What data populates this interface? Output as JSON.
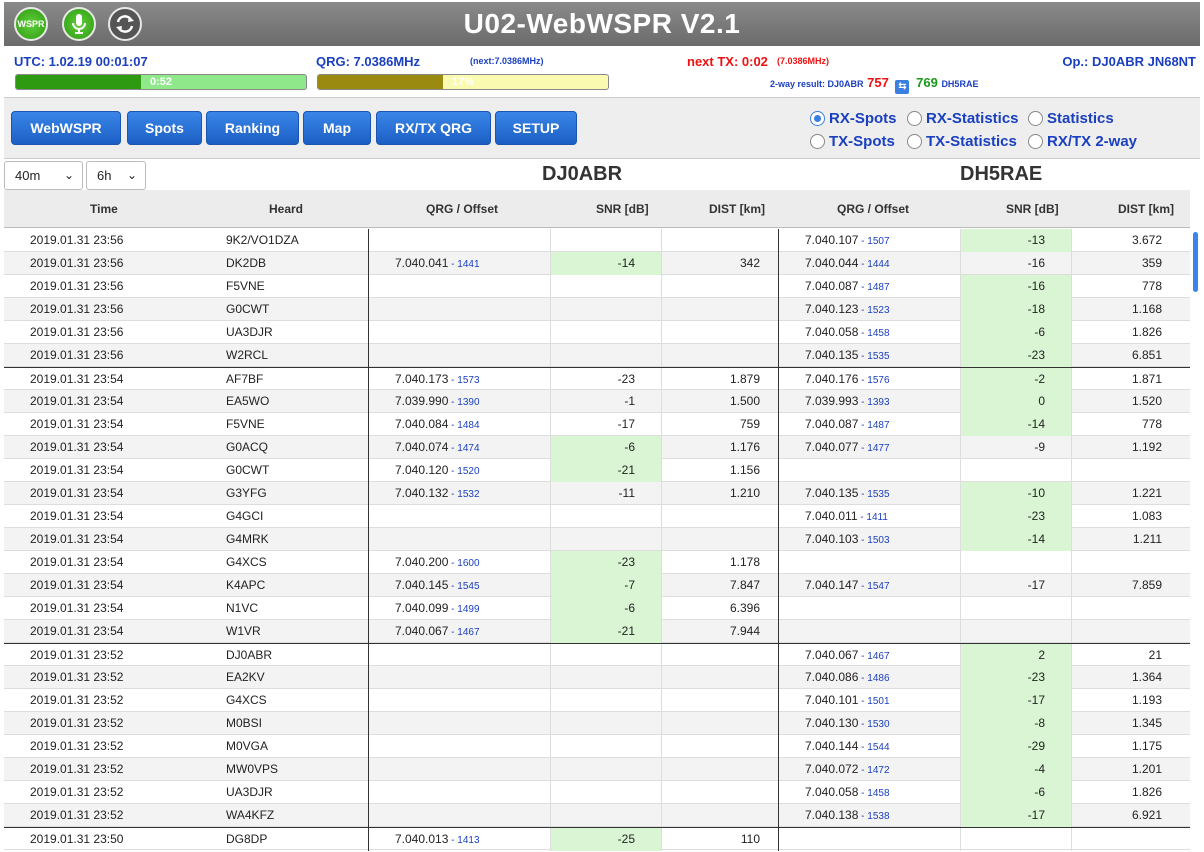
{
  "title": "U02-WebWSPR V2.1",
  "toolbar_icons": [
    "wspr-icon",
    "microphone-icon",
    "refresh-icon"
  ],
  "wspr_icon_label": "WSPR",
  "status": {
    "utc": "UTC: 1.02.19 00:01:07",
    "qrg": "QRG: 7.0386MHz",
    "next_qrg": "(next:7.0386MHz)",
    "next_tx": "next TX: 0:02",
    "next_tx_qrg": "(7.0386MHz)",
    "op": "Op.: DJ0ABR JN68NT",
    "timer_text": "0:52",
    "timer_fraction": 0.43,
    "progress_text": "17%",
    "progress_fraction": 0.43,
    "twoway_label": "2-way result: DJ0ABR",
    "twoway_a": "757",
    "twoway_b": "769",
    "twoway_b_call": "DH5RAE"
  },
  "nav": [
    "WebWSPR",
    "Spots",
    "Ranking",
    "Map",
    "RX/TX QRG",
    "SETUP"
  ],
  "views": [
    {
      "label": "RX-Spots",
      "selected": true
    },
    {
      "label": "RX-Statistics",
      "selected": false
    },
    {
      "label": "Statistics",
      "selected": false
    },
    {
      "label": "TX-Spots",
      "selected": false
    },
    {
      "label": "TX-Statistics",
      "selected": false
    },
    {
      "label": "RX/TX 2-way",
      "selected": false
    }
  ],
  "filters": {
    "band": "40m",
    "period": "6h"
  },
  "stations": {
    "a": "DJ0ABR",
    "b": "DH5RAE"
  },
  "columns": {
    "time": "Time",
    "heard": "Heard",
    "qrg1": "QRG / Offset",
    "snr1": "SNR [dB]",
    "dist1": "DIST [km]",
    "qrg2": "QRG / Offset",
    "snr2": "SNR [dB]",
    "dist2": "DIST [km]"
  },
  "rows": [
    {
      "t": "2019.01.31 23:56",
      "h": "9K2/VO1DZA",
      "q1": "",
      "o1": "",
      "s1": "",
      "d1": "",
      "q2": "7.040.107",
      "o2": "1507",
      "s2": "-13",
      "d2": "3.672",
      "g": false,
      "hl1": false,
      "hl2": true
    },
    {
      "t": "2019.01.31 23:56",
      "h": "DK2DB",
      "q1": "7.040.041",
      "o1": "1441",
      "s1": "-14",
      "d1": "342",
      "q2": "7.040.044",
      "o2": "1444",
      "s2": "-16",
      "d2": "359",
      "g": false,
      "hl1": true,
      "hl2": false
    },
    {
      "t": "2019.01.31 23:56",
      "h": "F5VNE",
      "q1": "",
      "o1": "",
      "s1": "",
      "d1": "",
      "q2": "7.040.087",
      "o2": "1487",
      "s2": "-16",
      "d2": "778",
      "g": false,
      "hl1": false,
      "hl2": true
    },
    {
      "t": "2019.01.31 23:56",
      "h": "G0CWT",
      "q1": "",
      "o1": "",
      "s1": "",
      "d1": "",
      "q2": "7.040.123",
      "o2": "1523",
      "s2": "-18",
      "d2": "1.168",
      "g": false,
      "hl1": false,
      "hl2": true
    },
    {
      "t": "2019.01.31 23:56",
      "h": "UA3DJR",
      "q1": "",
      "o1": "",
      "s1": "",
      "d1": "",
      "q2": "7.040.058",
      "o2": "1458",
      "s2": "-6",
      "d2": "1.826",
      "g": false,
      "hl1": false,
      "hl2": true
    },
    {
      "t": "2019.01.31 23:56",
      "h": "W2RCL",
      "q1": "",
      "o1": "",
      "s1": "",
      "d1": "",
      "q2": "7.040.135",
      "o2": "1535",
      "s2": "-23",
      "d2": "6.851",
      "g": false,
      "hl1": false,
      "hl2": true
    },
    {
      "t": "2019.01.31 23:54",
      "h": "AF7BF",
      "q1": "7.040.173",
      "o1": "1573",
      "s1": "-23",
      "d1": "1.879",
      "q2": "7.040.176",
      "o2": "1576",
      "s2": "-2",
      "d2": "1.871",
      "g": true,
      "hl1": false,
      "hl2": true
    },
    {
      "t": "2019.01.31 23:54",
      "h": "EA5WO",
      "q1": "7.039.990",
      "o1": "1390",
      "s1": "-1",
      "d1": "1.500",
      "q2": "7.039.993",
      "o2": "1393",
      "s2": "0",
      "d2": "1.520",
      "g": false,
      "hl1": false,
      "hl2": true
    },
    {
      "t": "2019.01.31 23:54",
      "h": "F5VNE",
      "q1": "7.040.084",
      "o1": "1484",
      "s1": "-17",
      "d1": "759",
      "q2": "7.040.087",
      "o2": "1487",
      "s2": "-14",
      "d2": "778",
      "g": false,
      "hl1": false,
      "hl2": true
    },
    {
      "t": "2019.01.31 23:54",
      "h": "G0ACQ",
      "q1": "7.040.074",
      "o1": "1474",
      "s1": "-6",
      "d1": "1.176",
      "q2": "7.040.077",
      "o2": "1477",
      "s2": "-9",
      "d2": "1.192",
      "g": false,
      "hl1": true,
      "hl2": false
    },
    {
      "t": "2019.01.31 23:54",
      "h": "G0CWT",
      "q1": "7.040.120",
      "o1": "1520",
      "s1": "-21",
      "d1": "1.156",
      "q2": "",
      "o2": "",
      "s2": "",
      "d2": "",
      "g": false,
      "hl1": true,
      "hl2": false
    },
    {
      "t": "2019.01.31 23:54",
      "h": "G3YFG",
      "q1": "7.040.132",
      "o1": "1532",
      "s1": "-11",
      "d1": "1.210",
      "q2": "7.040.135",
      "o2": "1535",
      "s2": "-10",
      "d2": "1.221",
      "g": false,
      "hl1": false,
      "hl2": true
    },
    {
      "t": "2019.01.31 23:54",
      "h": "G4GCI",
      "q1": "",
      "o1": "",
      "s1": "",
      "d1": "",
      "q2": "7.040.011",
      "o2": "1411",
      "s2": "-23",
      "d2": "1.083",
      "g": false,
      "hl1": false,
      "hl2": true
    },
    {
      "t": "2019.01.31 23:54",
      "h": "G4MRK",
      "q1": "",
      "o1": "",
      "s1": "",
      "d1": "",
      "q2": "7.040.103",
      "o2": "1503",
      "s2": "-14",
      "d2": "1.211",
      "g": false,
      "hl1": false,
      "hl2": true
    },
    {
      "t": "2019.01.31 23:54",
      "h": "G4XCS",
      "q1": "7.040.200",
      "o1": "1600",
      "s1": "-23",
      "d1": "1.178",
      "q2": "",
      "o2": "",
      "s2": "",
      "d2": "",
      "g": false,
      "hl1": true,
      "hl2": false
    },
    {
      "t": "2019.01.31 23:54",
      "h": "K4APC",
      "q1": "7.040.145",
      "o1": "1545",
      "s1": "-7",
      "d1": "7.847",
      "q2": "7.040.147",
      "o2": "1547",
      "s2": "-17",
      "d2": "7.859",
      "g": false,
      "hl1": true,
      "hl2": false
    },
    {
      "t": "2019.01.31 23:54",
      "h": "N1VC",
      "q1": "7.040.099",
      "o1": "1499",
      "s1": "-6",
      "d1": "6.396",
      "q2": "",
      "o2": "",
      "s2": "",
      "d2": "",
      "g": false,
      "hl1": true,
      "hl2": false
    },
    {
      "t": "2019.01.31 23:54",
      "h": "W1VR",
      "q1": "7.040.067",
      "o1": "1467",
      "s1": "-21",
      "d1": "7.944",
      "q2": "",
      "o2": "",
      "s2": "",
      "d2": "",
      "g": false,
      "hl1": true,
      "hl2": false
    },
    {
      "t": "2019.01.31 23:52",
      "h": "DJ0ABR",
      "q1": "",
      "o1": "",
      "s1": "",
      "d1": "",
      "q2": "7.040.067",
      "o2": "1467",
      "s2": "2",
      "d2": "21",
      "g": true,
      "hl1": false,
      "hl2": true
    },
    {
      "t": "2019.01.31 23:52",
      "h": "EA2KV",
      "q1": "",
      "o1": "",
      "s1": "",
      "d1": "",
      "q2": "7.040.086",
      "o2": "1486",
      "s2": "-23",
      "d2": "1.364",
      "g": false,
      "hl1": false,
      "hl2": true
    },
    {
      "t": "2019.01.31 23:52",
      "h": "G4XCS",
      "q1": "",
      "o1": "",
      "s1": "",
      "d1": "",
      "q2": "7.040.101",
      "o2": "1501",
      "s2": "-17",
      "d2": "1.193",
      "g": false,
      "hl1": false,
      "hl2": true
    },
    {
      "t": "2019.01.31 23:52",
      "h": "M0BSI",
      "q1": "",
      "o1": "",
      "s1": "",
      "d1": "",
      "q2": "7.040.130",
      "o2": "1530",
      "s2": "-8",
      "d2": "1.345",
      "g": false,
      "hl1": false,
      "hl2": true
    },
    {
      "t": "2019.01.31 23:52",
      "h": "M0VGA",
      "q1": "",
      "o1": "",
      "s1": "",
      "d1": "",
      "q2": "7.040.144",
      "o2": "1544",
      "s2": "-29",
      "d2": "1.175",
      "g": false,
      "hl1": false,
      "hl2": true
    },
    {
      "t": "2019.01.31 23:52",
      "h": "MW0VPS",
      "q1": "",
      "o1": "",
      "s1": "",
      "d1": "",
      "q2": "7.040.072",
      "o2": "1472",
      "s2": "-4",
      "d2": "1.201",
      "g": false,
      "hl1": false,
      "hl2": true
    },
    {
      "t": "2019.01.31 23:52",
      "h": "UA3DJR",
      "q1": "",
      "o1": "",
      "s1": "",
      "d1": "",
      "q2": "7.040.058",
      "o2": "1458",
      "s2": "-6",
      "d2": "1.826",
      "g": false,
      "hl1": false,
      "hl2": true
    },
    {
      "t": "2019.01.31 23:52",
      "h": "WA4KFZ",
      "q1": "",
      "o1": "",
      "s1": "",
      "d1": "",
      "q2": "7.040.138",
      "o2": "1538",
      "s2": "-17",
      "d2": "6.921",
      "g": false,
      "hl1": false,
      "hl2": true
    },
    {
      "t": "2019.01.31 23:50",
      "h": "DG8DP",
      "q1": "7.040.013",
      "o1": "1413",
      "s1": "-25",
      "d1": "110",
      "q2": "",
      "o2": "",
      "s2": "",
      "d2": "",
      "g": true,
      "hl1": true,
      "hl2": false
    }
  ]
}
